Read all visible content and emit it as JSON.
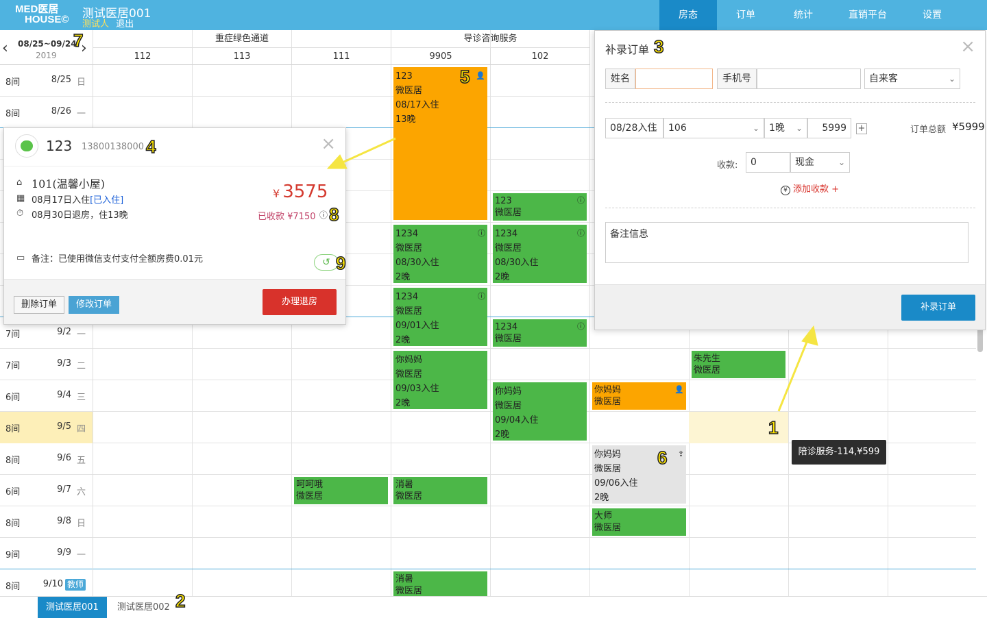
{
  "header": {
    "logo_line1": "MED医居",
    "logo_line2": "HOUSE©",
    "hotel_name": "测试医居001",
    "user_name": "测试人",
    "logout": "退出",
    "nav": [
      "房态",
      "订单",
      "统计",
      "直销平台",
      "设置"
    ],
    "active_nav": "房态"
  },
  "calendar": {
    "range": "08/25~09/24",
    "year": "2019",
    "prev_icon": "chevron-left-icon",
    "next_icon": "chevron-right-icon",
    "groups": [
      {
        "name": "重症绿色通道"
      },
      {
        "name": "导诊咨询服务"
      }
    ],
    "rooms": [
      "112",
      "113",
      "111",
      "9905",
      "102"
    ],
    "rows": [
      {
        "count": "8间",
        "date": "8/25",
        "weekday": "日"
      },
      {
        "count": "8间",
        "date": "8/26",
        "weekday": "一"
      },
      {
        "count": "",
        "date": "",
        "weekday": ""
      },
      {
        "count": "",
        "date": "",
        "weekday": ""
      },
      {
        "count": "",
        "date": "",
        "weekday": ""
      },
      {
        "count": "",
        "date": "",
        "weekday": ""
      },
      {
        "count": "",
        "date": "",
        "weekday": ""
      },
      {
        "count": "",
        "date": "",
        "weekday": ""
      },
      {
        "count": "7间",
        "date": "9/2",
        "weekday": "一"
      },
      {
        "count": "7间",
        "date": "9/3",
        "weekday": "二"
      },
      {
        "count": "6间",
        "date": "9/4",
        "weekday": "三"
      },
      {
        "count": "8间",
        "date": "9/5",
        "weekday": "四"
      },
      {
        "count": "8间",
        "date": "9/6",
        "weekday": "五"
      },
      {
        "count": "6间",
        "date": "9/7",
        "weekday": "六"
      },
      {
        "count": "8间",
        "date": "9/8",
        "weekday": "日"
      },
      {
        "count": "9间",
        "date": "9/9",
        "weekday": "一"
      },
      {
        "count": "8间",
        "date": "9/10",
        "tag": "教师"
      }
    ],
    "bookings": [
      {
        "lines": [
          "123",
          "微医居",
          "08/17入住",
          "13晚"
        ],
        "color": "orange",
        "icon": "user-icon"
      },
      {
        "lines": [
          "123",
          "微医居"
        ],
        "color": "green",
        "icon": "alert-icon"
      },
      {
        "lines": [
          "1234",
          "微医居",
          "08/30入住",
          "2晚"
        ],
        "color": "green",
        "icon": "alert-icon"
      },
      {
        "lines": [
          "1234",
          "微医居",
          "08/30入住",
          "2晚"
        ],
        "color": "green",
        "icon": "alert-icon"
      },
      {
        "lines": [
          "1234",
          "微医居",
          "09/01入住",
          "2晚"
        ],
        "color": "green",
        "icon": "alert-icon"
      },
      {
        "lines": [
          "1234",
          "微医居"
        ],
        "color": "green",
        "icon": "alert-icon"
      },
      {
        "lines": [
          "你妈妈",
          "微医居",
          "09/03入住",
          "2晚"
        ],
        "color": "green"
      },
      {
        "lines": [
          "朱先生",
          "微医居"
        ],
        "color": "green"
      },
      {
        "lines": [
          "你妈妈",
          "微医居",
          "09/04入住",
          "2晚"
        ],
        "color": "green"
      },
      {
        "lines": [
          "你妈妈",
          "微医居"
        ],
        "color": "orange",
        "icon": "user-icon"
      },
      {
        "lines": [
          "你妈妈",
          "微医居",
          "09/06入住",
          "2晚"
        ],
        "color": "gray",
        "icon": "checkout-icon"
      },
      {
        "lines": [
          "呵呵哦",
          "微医居"
        ],
        "color": "green"
      },
      {
        "lines": [
          "消暑",
          "微医居"
        ],
        "color": "green"
      },
      {
        "lines": [
          "大师",
          "微医居"
        ],
        "color": "green"
      },
      {
        "lines": [
          "消暑",
          "微医居"
        ],
        "color": "green"
      }
    ]
  },
  "order_popup": {
    "guest_name": "123",
    "phone": "13800138000",
    "room": "101(温馨小屋)",
    "checkin": "08月17日入住",
    "checkin_status": "[已入住]",
    "checkout": "08月30日退房，住13晚",
    "currency": "¥",
    "price": "3575",
    "paid": "已收款 ¥7150",
    "note": "备注：已使用微信支付支付全额房费0.01元",
    "delete_label": "删除订单",
    "edit_label": "修改订单",
    "checkout_label": "办理退房",
    "close": "×"
  },
  "add_order_panel": {
    "title": "补录订单",
    "close": "×",
    "name_label": "姓名",
    "name_value": "",
    "phone_label": "手机号",
    "phone_value": "",
    "source": "自来客",
    "checkin_date": "08/28入住",
    "room": "106",
    "nights": "1晚",
    "price": "5999",
    "add_room": "+",
    "total_label": "订单总额",
    "total_value": "¥5999",
    "received_label": "收款:",
    "received_value": "0",
    "payment_method": "现金",
    "add_payment": "添加收款 +",
    "remark_placeholder": "备注信息",
    "submit_label": "补录订单"
  },
  "tooltip": "陪诊服务-114,¥599",
  "footer_tabs": [
    "测试医居001",
    "测试医居002"
  ],
  "annotations": [
    "1",
    "2",
    "3",
    "4",
    "5",
    "6",
    "7",
    "8",
    "9"
  ],
  "colors": {
    "header": "#4fb3e0",
    "active": "#1a8ac8",
    "green": "#4cb748",
    "orange": "#fca500",
    "red": "#d8322b",
    "arrow": "#f5e542"
  }
}
